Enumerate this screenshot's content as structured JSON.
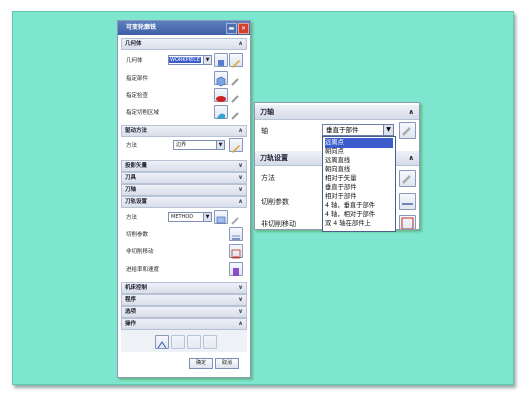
{
  "dialog": {
    "title": "可变轮廓铣",
    "sections": {
      "geometry": "几何体",
      "drive": "驱动方法",
      "projection": "投影矢量",
      "tool": "刀具",
      "axis": "刀轴",
      "toolpath": "刀轨设置",
      "machine": "机床控制",
      "program": "程序",
      "options": "选项",
      "actions": "操作"
    },
    "geometry": {
      "geometry_label": "几何体",
      "geometry_value": "WORKPIECE",
      "part_label": "指定部件",
      "check_label": "指定检查",
      "cut_area_label": "指定切削区域"
    },
    "drive": {
      "method_label": "方法",
      "method_value": "边界"
    },
    "toolpath": {
      "method_label": "方法",
      "method_value": "METHOD",
      "cut_params_label": "切削参数",
      "non_cut_label": "非切削移动",
      "feed_label": "进给率和速度"
    },
    "ok_label": "确定",
    "cancel_label": "取消"
  },
  "panel": {
    "axis_section": "刀轴",
    "axis_label": "轴",
    "axis_value": "垂直于部件",
    "toolpath_section": "刀轨设置",
    "method_label": "方法",
    "cut_params_label": "切削参数",
    "non_cut_label": "非切削移动",
    "options": [
      "远离点",
      "朝向点",
      "远离直线",
      "朝向直线",
      "相对于矢量",
      "垂直于部件",
      "相对于部件",
      "4 轴，垂直于部件",
      "4 轴，相对于部件",
      "双 4 轴在部件上"
    ],
    "selected_index": 0
  }
}
